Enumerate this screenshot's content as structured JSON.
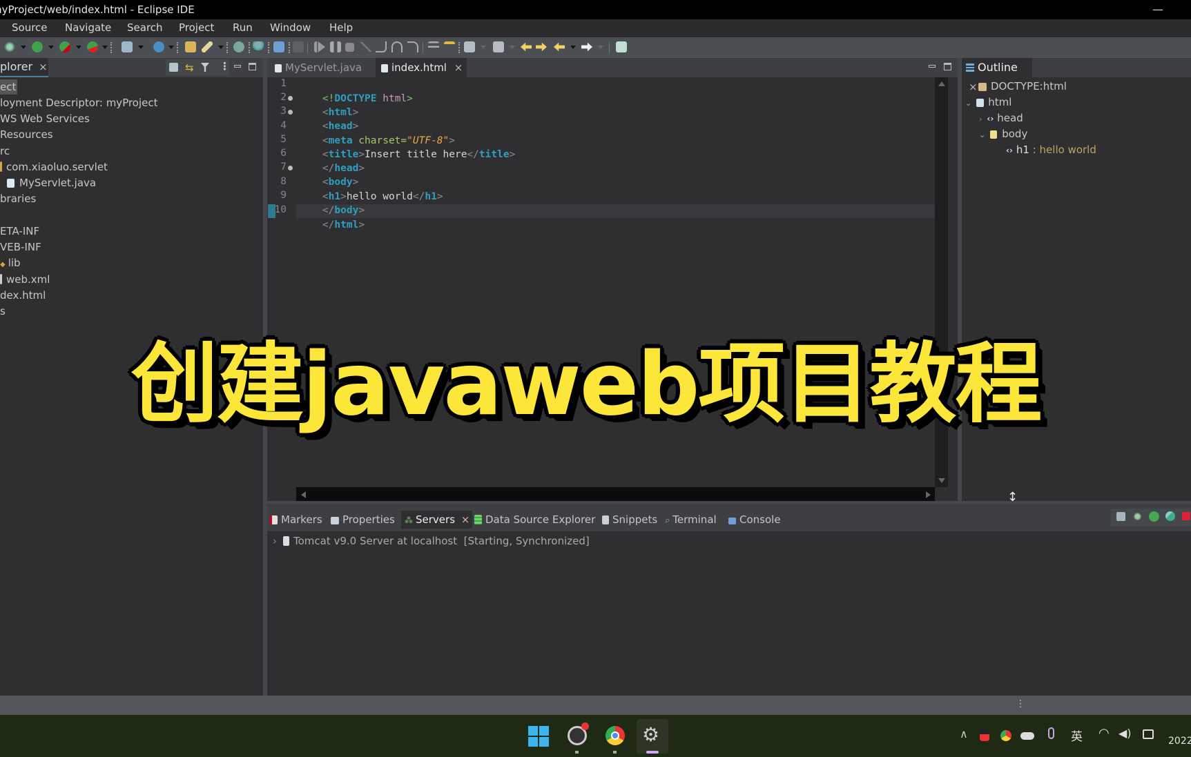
{
  "window": {
    "title": "myProject/web/index.html - Eclipse IDE",
    "minimize_glyph": "—"
  },
  "menu": [
    "Source",
    "Navigate",
    "Search",
    "Project",
    "Run",
    "Window",
    "Help"
  ],
  "toolbar": {
    "icons": [
      "debug-icon",
      "run-icon",
      "run-coverage-icon",
      "external-tools-icon",
      "new-server-icon",
      "new-web-service-icon",
      "open-folder-icon",
      "pencil-icon",
      "globe-icon",
      "person-icon",
      "terminal-icon",
      "skip-breakpoints-icon",
      "resume-icon",
      "suspend-icon",
      "terminate-icon",
      "disconnect-icon",
      "step-into-icon",
      "step-over-icon",
      "step-return-icon",
      "drop-frame-icon",
      "use-step-filters-icon",
      "next-annotation-icon",
      "previous-annotation-icon",
      "back-icon",
      "forward-icon",
      "task-icon"
    ]
  },
  "explorer": {
    "tab_label": "plorer",
    "close_glyph": "×",
    "tree": [
      {
        "label": "ect",
        "selected": true
      },
      {
        "label": "loyment Descriptor: myProject"
      },
      {
        "label": "WS Web Services"
      },
      {
        "label": " Resources"
      },
      {
        "label": "rc"
      },
      {
        "label": "com.xiaoluo.servlet"
      },
      {
        "label": "MyServlet.java"
      },
      {
        "label": "braries"
      },
      {
        "label": ""
      },
      {
        "label": "ETA-INF"
      },
      {
        "label": "VEB-INF"
      },
      {
        "label": "lib"
      },
      {
        "label": "web.xml"
      },
      {
        "label": "dex.html"
      },
      {
        "label": "s"
      }
    ]
  },
  "editor": {
    "tabs": [
      {
        "label": "MyServlet.java",
        "active": false
      },
      {
        "label": "index.html",
        "active": true,
        "close": "×"
      }
    ],
    "lines": [
      {
        "n": "1",
        "fold": false
      },
      {
        "n": "2",
        "fold": true
      },
      {
        "n": "3",
        "fold": true
      },
      {
        "n": "4",
        "fold": false
      },
      {
        "n": "5",
        "fold": false
      },
      {
        "n": "6",
        "fold": false
      },
      {
        "n": "7",
        "fold": true
      },
      {
        "n": "8",
        "fold": false
      },
      {
        "n": "9",
        "fold": false
      },
      {
        "n": "10",
        "fold": false
      }
    ],
    "code": {
      "l1_open": "<!",
      "l1_doctype": "DOCTYPE",
      "l1_name": " html",
      "l1_close": ">",
      "l2_tag": "html",
      "l3_tag": "head",
      "l4_tag": "meta",
      "l4_attr": " charset=",
      "l4_val": "\"UTF-8\"",
      "l5_tag": "title",
      "l5_text": "Insert title here",
      "l6_tag": "head",
      "l7_tag": "body",
      "l8_tag": "h1",
      "l8_text": "hello world",
      "l9_tag": "body",
      "l10_tag": "html",
      "lt": "<",
      "gt": ">",
      "lt_slash": "</"
    }
  },
  "outline": {
    "tab_label": "Outline",
    "close_glyph": "×",
    "items": [
      {
        "label": "DOCTYPE:html"
      },
      {
        "label": "html",
        "expanded": true
      },
      {
        "label": "head",
        "expanded": false
      },
      {
        "label": "body",
        "expanded": true
      },
      {
        "label": "h1",
        "suffix": " : ",
        "value": "hello world"
      }
    ]
  },
  "bottom_panel": {
    "tabs": [
      {
        "label": "Markers"
      },
      {
        "label": "Properties"
      },
      {
        "label": "Servers",
        "active": true,
        "close": "×"
      },
      {
        "label": "Data Source Explorer"
      },
      {
        "label": "Snippets"
      },
      {
        "label": "Terminal"
      },
      {
        "label": "Console"
      }
    ],
    "servers": [
      {
        "name": "Tomcat v9.0 Server at localhost",
        "status": "[Starting, Synchronized]"
      }
    ]
  },
  "taskbar": {
    "apps": [
      "windows-start-icon",
      "obs-icon",
      "chrome-icon",
      "settings-app-icon"
    ],
    "tray": {
      "ime": "英",
      "clock": "2022"
    }
  },
  "caption": {
    "text": "创建javaweb项目教程",
    "color": "#fde63a"
  }
}
